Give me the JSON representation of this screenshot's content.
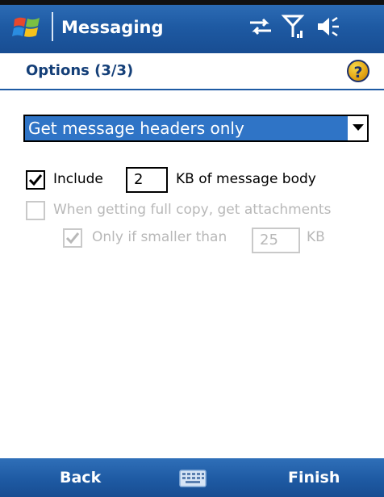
{
  "titlebar": {
    "app_title": "Messaging",
    "start_icon": "windows-flag-icon",
    "tray_icons": [
      "connectivity-icon",
      "signal-icon",
      "volume-icon"
    ]
  },
  "header": {
    "title": "Options (3/3)",
    "help_icon": "help-icon",
    "help_glyph": "?"
  },
  "download_option": {
    "selected": "Get message headers only"
  },
  "include_body": {
    "checked": true,
    "label_before": "Include",
    "kb_value": "2",
    "label_after": "KB of message body"
  },
  "get_attachments": {
    "checked": false,
    "enabled": false,
    "label": "When getting full copy, get attachments"
  },
  "only_smaller": {
    "checked": true,
    "enabled": false,
    "label": "Only if smaller than",
    "kb_value": "25",
    "unit": "KB"
  },
  "softkeys": {
    "left": "Back",
    "right": "Finish",
    "input_icon": "keyboard-icon"
  },
  "colors": {
    "bar_blue": "#1e5aa3",
    "selection_blue": "#2f74c6",
    "header_text": "#143f78",
    "disabled_text": "#b8b8b8"
  }
}
